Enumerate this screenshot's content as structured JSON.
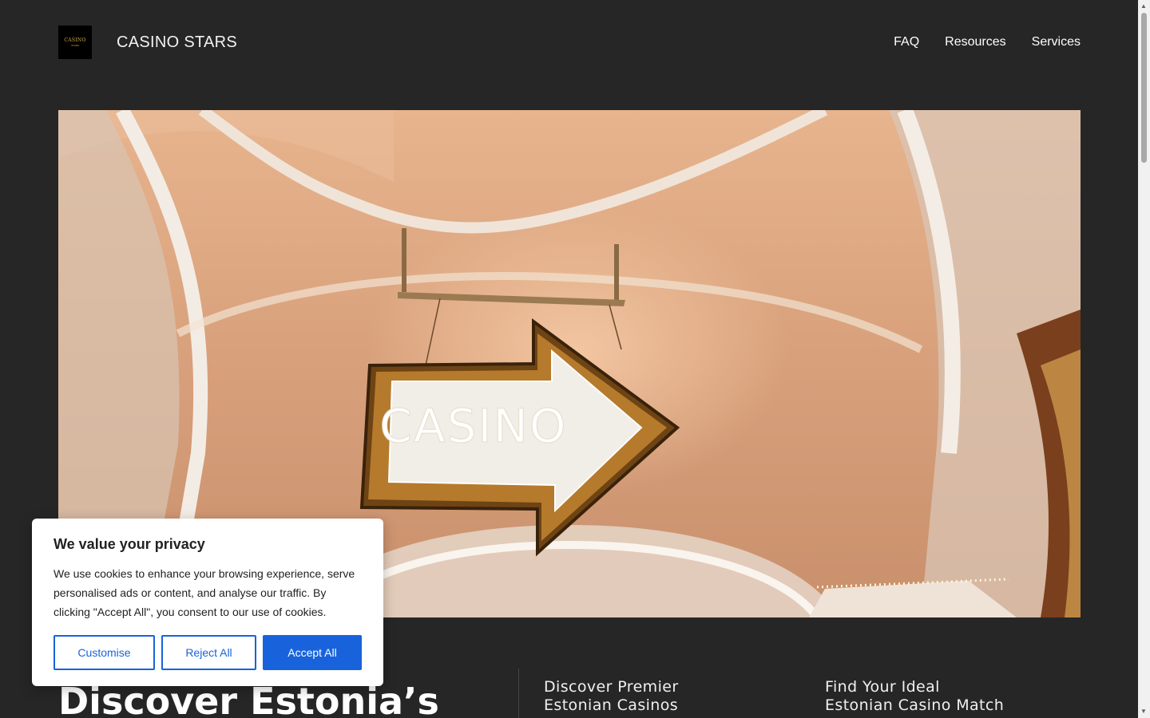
{
  "header": {
    "logo_text": "CASINO",
    "logo_sub": "STARS",
    "site_title": "CASINO STARS",
    "nav": [
      "FAQ",
      "Resources",
      "Services"
    ]
  },
  "hero": {
    "sign_text": "CASINO"
  },
  "main": {
    "title": "Discover Estonia’s",
    "columns": [
      {
        "heading_line1": "Discover Premier",
        "heading_line2": "Estonian Casinos"
      },
      {
        "heading_line1": "Find Your Ideal",
        "heading_line2": "Estonian Casino Match"
      }
    ]
  },
  "cookie": {
    "title": "We value your privacy",
    "body": "We use cookies to enhance your browsing experience, serve personalised ads or content, and analyse our traffic. By clicking \"Accept All\", you consent to our use of cookies.",
    "customise": "Customise",
    "reject": "Reject All",
    "accept": "Accept All"
  },
  "colors": {
    "background": "#262626",
    "accent": "#1863dc"
  }
}
